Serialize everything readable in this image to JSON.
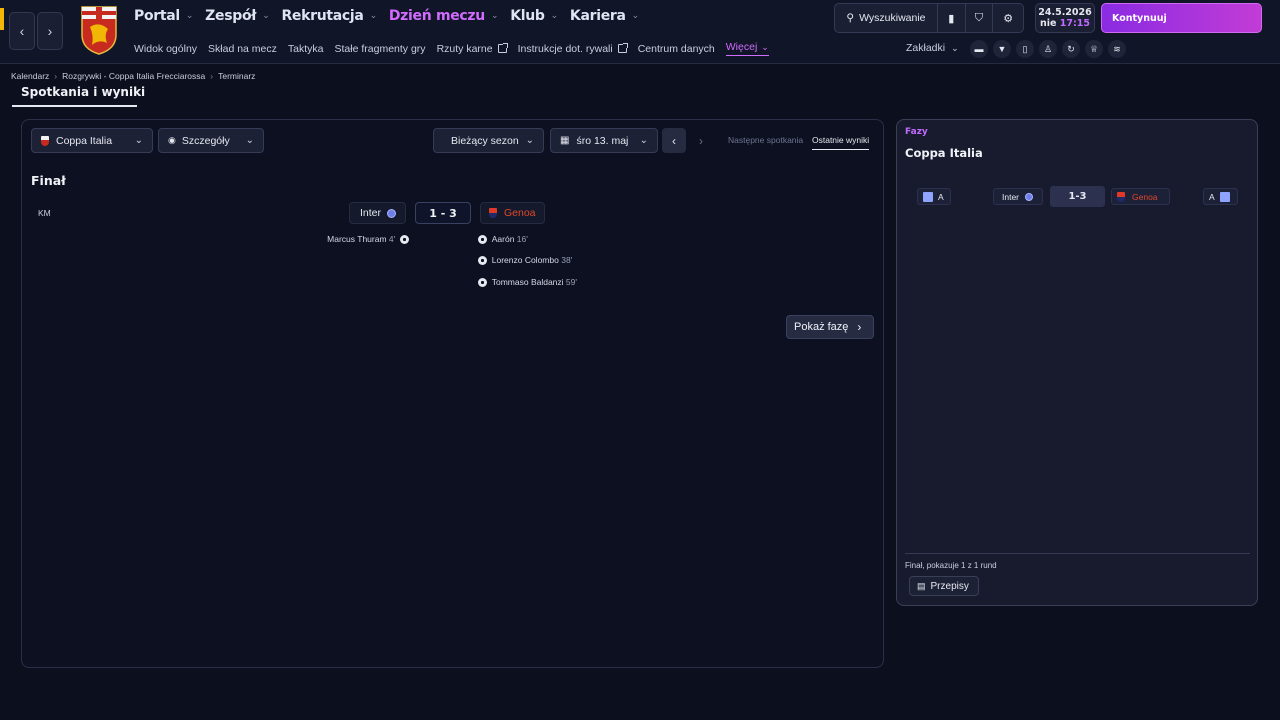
{
  "topbar": {
    "nav": [
      {
        "label": "Portal",
        "active": false
      },
      {
        "label": "Zespół",
        "active": false
      },
      {
        "label": "Rekrutacja",
        "active": false
      },
      {
        "label": "Dzień meczu",
        "active": true
      },
      {
        "label": "Klub",
        "active": false
      },
      {
        "label": "Kariera",
        "active": false
      }
    ],
    "subnav": [
      "Widok ogólny",
      "Skład na mecz",
      "Taktyka",
      "Stałe fragmenty gry",
      "Rzuty karne",
      "Instrukcje dot. rywali",
      "Centrum danych",
      "Więcej"
    ],
    "search_label": "Wyszukiwanie",
    "date": "24.5.2026",
    "day": "nie",
    "time": "17:15",
    "continue_label": "Kontynuuj",
    "bookmarks_label": "Zakładki"
  },
  "breadcrumb": [
    "Kalendarz",
    "Rozgrywki - Coppa Italia Frecciarossa",
    "Terminarz"
  ],
  "page_title": "Spotkania i wyniki",
  "filters": {
    "competition": "Coppa Italia",
    "view": "Szczegóły",
    "season": "Bieżący sezon",
    "date": "śro 13. maj",
    "tab_next": "Następne spotkania",
    "tab_last": "Ostatnie wyniki"
  },
  "match": {
    "stage": "Finał",
    "venue_tag": "KM",
    "home": "Inter",
    "score": "1 - 3",
    "away": "Genoa",
    "home_scorers": [
      {
        "name": "Marcus Thuram",
        "minute": "4'"
      }
    ],
    "away_scorers": [
      {
        "name": "Aarón",
        "minute": "16'"
      },
      {
        "name": "Lorenzo Colombo",
        "minute": "38'"
      },
      {
        "name": "Tommaso Baldanzi",
        "minute": "59'"
      }
    ],
    "show_stage_label": "Pokaż fazę"
  },
  "side": {
    "header": "Fazy",
    "title": "Coppa Italia",
    "left_group": "A",
    "home": "Inter",
    "score": "1-3",
    "away": "Genoa",
    "right_group": "A",
    "footer": "Finał, pokazuje 1 z 1 rund",
    "rules_label": "Przepisy"
  },
  "colors": {
    "accent": "#c06bff",
    "genoa": "#e0472a",
    "background": "#0b0f1e"
  }
}
